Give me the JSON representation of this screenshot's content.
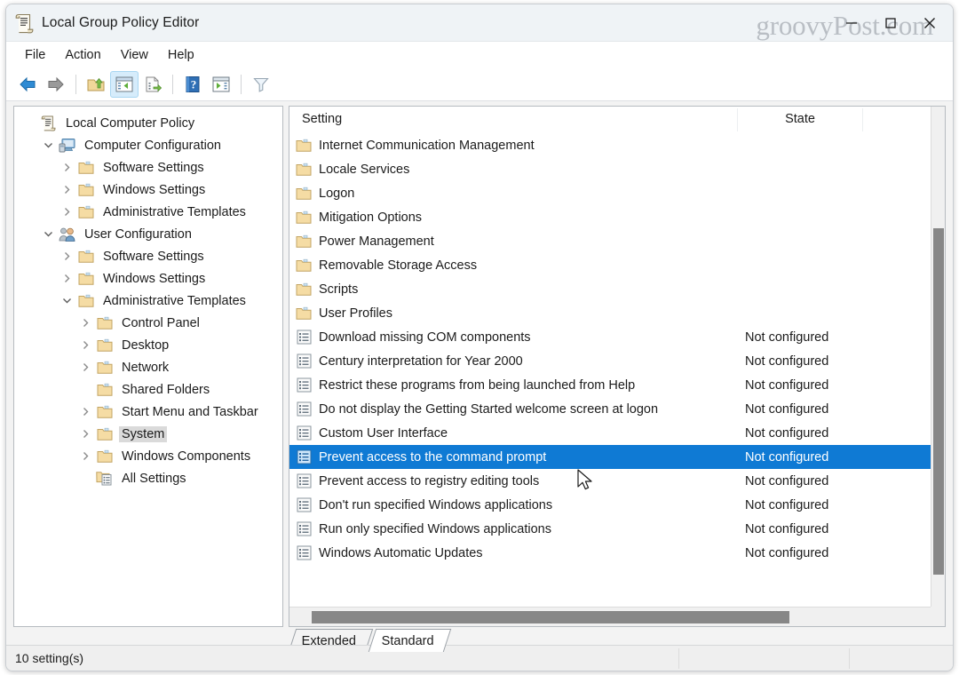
{
  "window": {
    "title": "Local Group Policy Editor",
    "icon": "policy-scroll-icon",
    "watermark": "groovyPost.com",
    "controls": {
      "minimize": "minimize-icon",
      "maximize": "maximize-icon",
      "close": "close-icon"
    }
  },
  "menubar": {
    "items": [
      {
        "label": "File"
      },
      {
        "label": "Action"
      },
      {
        "label": "View"
      },
      {
        "label": "Help"
      }
    ]
  },
  "toolbar": {
    "buttons": [
      {
        "name": "back-arrow-icon",
        "icon": "arrow-left",
        "active": false
      },
      {
        "name": "forward-arrow-icon",
        "icon": "arrow-right",
        "active": false
      },
      {
        "name": "up-one-level-icon",
        "icon": "folder-up",
        "active": false
      },
      {
        "name": "show-hide-console-tree-icon",
        "icon": "window-pane-left",
        "active": true
      },
      {
        "name": "export-list-icon",
        "icon": "document-export",
        "active": false
      },
      {
        "name": "help-icon",
        "icon": "question-book",
        "active": false
      },
      {
        "name": "show-hide-action-pane-icon",
        "icon": "window-pane-right",
        "active": false
      },
      {
        "name": "filter-icon",
        "icon": "funnel",
        "active": false
      }
    ]
  },
  "tree": {
    "items": [
      {
        "label": "Local Computer Policy",
        "indent": 0,
        "chevron": "none",
        "icon": "policy-scroll-icon",
        "selected": false
      },
      {
        "label": "Computer Configuration",
        "indent": 1,
        "chevron": "expanded",
        "icon": "computer-icon",
        "selected": false
      },
      {
        "label": "Software Settings",
        "indent": 2,
        "chevron": "collapsed",
        "icon": "folder-icon",
        "selected": false
      },
      {
        "label": "Windows Settings",
        "indent": 2,
        "chevron": "collapsed",
        "icon": "folder-icon",
        "selected": false
      },
      {
        "label": "Administrative Templates",
        "indent": 2,
        "chevron": "collapsed",
        "icon": "folder-icon",
        "selected": false
      },
      {
        "label": "User Configuration",
        "indent": 1,
        "chevron": "expanded",
        "icon": "user-icon",
        "selected": false
      },
      {
        "label": "Software Settings",
        "indent": 2,
        "chevron": "collapsed",
        "icon": "folder-icon",
        "selected": false
      },
      {
        "label": "Windows Settings",
        "indent": 2,
        "chevron": "collapsed",
        "icon": "folder-icon",
        "selected": false
      },
      {
        "label": "Administrative Templates",
        "indent": 2,
        "chevron": "expanded",
        "icon": "folder-icon",
        "selected": false
      },
      {
        "label": "Control Panel",
        "indent": 3,
        "chevron": "collapsed",
        "icon": "folder-icon",
        "selected": false
      },
      {
        "label": "Desktop",
        "indent": 3,
        "chevron": "collapsed",
        "icon": "folder-icon",
        "selected": false
      },
      {
        "label": "Network",
        "indent": 3,
        "chevron": "collapsed",
        "icon": "folder-icon",
        "selected": false
      },
      {
        "label": "Shared Folders",
        "indent": 3,
        "chevron": "none",
        "icon": "folder-icon",
        "selected": false
      },
      {
        "label": "Start Menu and Taskbar",
        "indent": 3,
        "chevron": "collapsed",
        "icon": "folder-icon",
        "selected": false
      },
      {
        "label": "System",
        "indent": 3,
        "chevron": "collapsed",
        "icon": "folder-icon",
        "selected": true
      },
      {
        "label": "Windows Components",
        "indent": 3,
        "chevron": "collapsed",
        "icon": "folder-icon",
        "selected": false
      },
      {
        "label": "All Settings",
        "indent": 3,
        "chevron": "none",
        "icon": "all-settings-icon",
        "selected": false
      }
    ]
  },
  "list": {
    "columns": [
      {
        "label": "Setting"
      },
      {
        "label": "State"
      }
    ],
    "rows": [
      {
        "name": "Internet Communication Management",
        "state": "",
        "icon": "folder-icon",
        "selected": false
      },
      {
        "name": "Locale Services",
        "state": "",
        "icon": "folder-icon",
        "selected": false
      },
      {
        "name": "Logon",
        "state": "",
        "icon": "folder-icon",
        "selected": false
      },
      {
        "name": "Mitigation Options",
        "state": "",
        "icon": "folder-icon",
        "selected": false
      },
      {
        "name": "Power Management",
        "state": "",
        "icon": "folder-icon",
        "selected": false
      },
      {
        "name": "Removable Storage Access",
        "state": "",
        "icon": "folder-icon",
        "selected": false
      },
      {
        "name": "Scripts",
        "state": "",
        "icon": "folder-icon",
        "selected": false
      },
      {
        "name": "User Profiles",
        "state": "",
        "icon": "folder-icon",
        "selected": false
      },
      {
        "name": "Download missing COM components",
        "state": "Not configured",
        "icon": "policy-setting-icon",
        "selected": false
      },
      {
        "name": "Century interpretation for Year 2000",
        "state": "Not configured",
        "icon": "policy-setting-icon",
        "selected": false
      },
      {
        "name": "Restrict these programs from being launched from Help",
        "state": "Not configured",
        "icon": "policy-setting-icon",
        "selected": false
      },
      {
        "name": "Do not display the Getting Started welcome screen at logon",
        "state": "Not configured",
        "icon": "policy-setting-icon",
        "selected": false
      },
      {
        "name": "Custom User Interface",
        "state": "Not configured",
        "icon": "policy-setting-icon",
        "selected": false
      },
      {
        "name": "Prevent access to the command prompt",
        "state": "Not configured",
        "icon": "policy-setting-icon",
        "selected": true
      },
      {
        "name": "Prevent access to registry editing tools",
        "state": "Not configured",
        "icon": "policy-setting-icon",
        "selected": false
      },
      {
        "name": "Don't run specified Windows applications",
        "state": "Not configured",
        "icon": "policy-setting-icon",
        "selected": false
      },
      {
        "name": "Run only specified Windows applications",
        "state": "Not configured",
        "icon": "policy-setting-icon",
        "selected": false
      },
      {
        "name": "Windows Automatic Updates",
        "state": "Not configured",
        "icon": "policy-setting-icon",
        "selected": false
      }
    ]
  },
  "tabs": [
    {
      "label": "Extended",
      "active": false
    },
    {
      "label": "Standard",
      "active": true
    }
  ],
  "statusbar": {
    "text": "10 setting(s)"
  },
  "colors": {
    "selection_blue": "#0f7ad4",
    "tree_selection_gray": "#dadada",
    "titlebar_bg": "#eff3f6",
    "pane_bg": "#f3f3f3",
    "scrollbar_thumb": "#878787",
    "toolbar_active_bg": "#d6ecfb"
  }
}
